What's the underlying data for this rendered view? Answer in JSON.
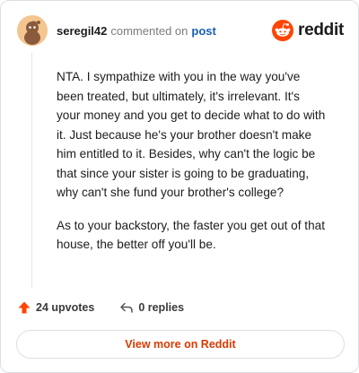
{
  "header": {
    "username": "seregil42",
    "commented_text": "commented on",
    "post_link": "post",
    "brand_name": "reddit",
    "brand_color": "#ff4500",
    "avatar_icon": "snoo-avatar-icon"
  },
  "comment": {
    "paragraphs": [
      "NTA. I sympathize with you in the way you've been treated, but ultimately, it's irrelevant. It's your money and you get to decide what to do with it. Just because he's your brother doesn't make him entitled to it. Besides, why can't the logic be that since your sister is going to be graduating, why can't she fund your brother's college?",
      "As to your backstory, the faster you get out of that house, the better off you'll be."
    ]
  },
  "actions": {
    "upvotes_label": "24 upvotes",
    "upvote_color": "#ff4500",
    "replies_label": "0 replies"
  },
  "footer": {
    "view_more_label": "View more on Reddit",
    "accent_color": "#d93a00"
  }
}
